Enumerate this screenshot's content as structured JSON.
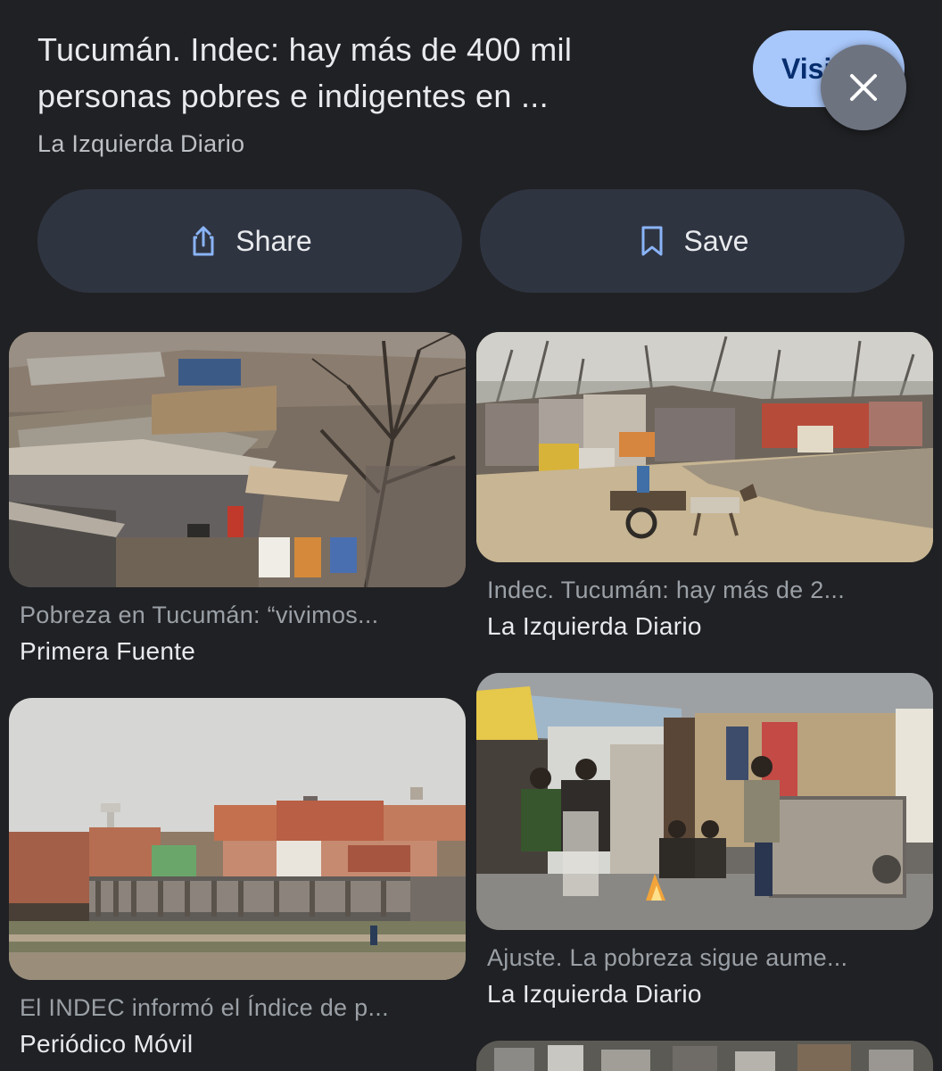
{
  "header": {
    "title_line1": "Tucumán. Indec: hay más de 400 mil",
    "title_line2": "personas pobres e indigentes en ...",
    "source": "La Izquierda Diario",
    "visit_label": "Visit",
    "close_icon": "close-icon"
  },
  "actions": {
    "share_label": "Share",
    "share_icon": "share-icon",
    "save_label": "Save",
    "save_icon": "bookmark-icon"
  },
  "results": [
    {
      "caption": "Pobreza en Tucumán: “vivimos...",
      "site": "Primera Fuente"
    },
    {
      "caption": "Indec. Tucumán: hay más de 2...",
      "site": "La Izquierda Diario"
    },
    {
      "caption": "El INDEC informó el Índice de p...",
      "site": "Periódico Móvil"
    },
    {
      "caption": "Ajuste. La pobreza sigue aume...",
      "site": "La Izquierda Diario"
    }
  ],
  "colors": {
    "background": "#202124",
    "accent": "#a8c7fa",
    "button_bg": "#2f3441",
    "icon_blue": "#8ab4f8"
  }
}
